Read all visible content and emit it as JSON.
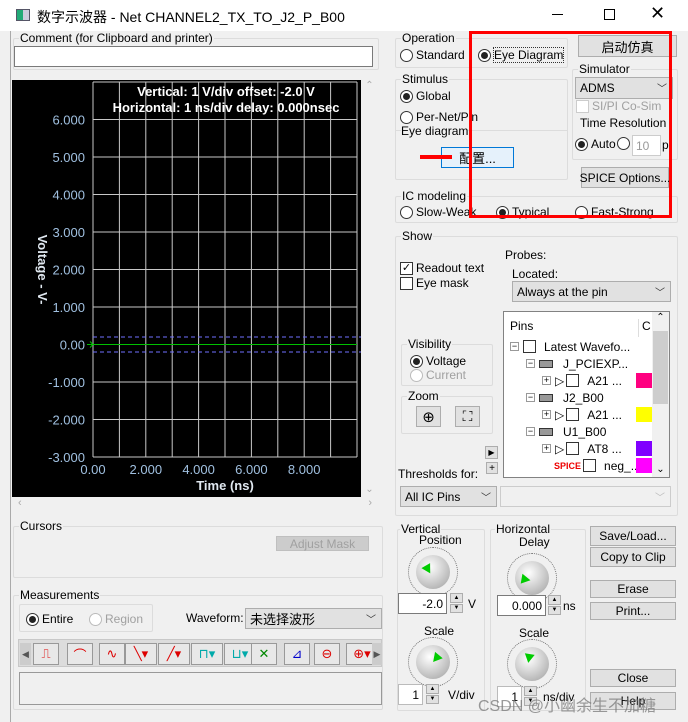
{
  "window": {
    "title": "数字示波器 - Net CHANNEL2_TX_TO_J2_P_B00",
    "controls": [
      "minimize",
      "maximize",
      "close"
    ]
  },
  "comment": {
    "label": "Comment (for Clipboard and printer)",
    "value": ""
  },
  "scope": {
    "readout_vertical": "Vertical: 1  V/div  offset: -2.0 V",
    "readout_horizontal": "Horizontal: 1 ns/div  delay: 0.000nsec"
  },
  "chart_data": {
    "type": "line",
    "xlabel": "Time  (ns)",
    "ylabel": "Voltage  - V-",
    "xlim": [
      0,
      10
    ],
    "ylim": [
      -3,
      7
    ],
    "grid": true,
    "yticks": [
      "6.000",
      "5.000",
      "4.000",
      "3.000",
      "2.000",
      "1.000",
      "0.00",
      "-1.000",
      "-2.000",
      "-3.000"
    ],
    "ytick_values": [
      6,
      5,
      4,
      3,
      2,
      1,
      0,
      -1,
      -2,
      -3
    ],
    "xticks": [
      "0.00",
      "2.000",
      "4.000",
      "6.000",
      "8.000"
    ],
    "xtick_values": [
      0,
      2,
      4,
      6,
      8
    ],
    "series": [
      {
        "x": [
          0,
          10
        ],
        "y": [
          0,
          0
        ],
        "color": "#00c000"
      }
    ],
    "threshold_lines": [
      {
        "y": 0.2,
        "color": "#7070ff",
        "style": "dashed"
      },
      {
        "y": -0.2,
        "color": "#7070ff",
        "style": "dashed"
      }
    ],
    "background": "#000000",
    "grid_color": "#c8c8c8",
    "tick_color": "#a0c0e0"
  },
  "cursors": {
    "label": "Cursors",
    "adjust_mask": "Adjust Mask"
  },
  "measurements": {
    "label": "Measurements",
    "entire": "Entire",
    "region": "Region",
    "waveform_label": "Waveform:",
    "waveform_value": "未选择波形",
    "tools": [
      "period",
      "rise",
      "fall",
      "slew-fall",
      "slew-rise",
      "overshoot-high",
      "overshoot-low",
      "crossing",
      "delay",
      "eye",
      "eye-options"
    ]
  },
  "operation": {
    "label": "Operation",
    "standard": "Standard",
    "eye_diagram": "Eye Diagram",
    "selected": "Eye Diagram"
  },
  "start_sim": "启动仿真",
  "stimulus": {
    "label": "Stimulus",
    "global": "Global",
    "per_net": "Per-Net/Pin",
    "selected": "Global"
  },
  "eye_diagram": {
    "label": "Eye diagram",
    "config": "配置..."
  },
  "simulator": {
    "label": "Simulator",
    "value": "ADMS",
    "cosim": "SI/PI Co-Sim",
    "time_res": "Time Resolution",
    "auto": "Auto",
    "ps_value": "10",
    "ps": "ps"
  },
  "spice_options": "SPICE Options...",
  "ic_modeling": {
    "label": "IC modeling",
    "slow": "Slow-Weak",
    "typical": "Typical",
    "fast": "Fast-Strong",
    "selected": "Typical"
  },
  "show": {
    "label": "Show",
    "readout": "Readout text",
    "readout_checked": true,
    "eye_mask": "Eye mask",
    "eye_mask_checked": false
  },
  "probes": {
    "label": "Probes:",
    "located": "Located:",
    "located_value": "Always at the pin"
  },
  "pins": {
    "col_pins": "Pins",
    "col_c": "C",
    "rows": [
      {
        "label": "Latest Wavefo...",
        "level": 0,
        "type": "root"
      },
      {
        "label": "J_PCIEXP...",
        "level": 1,
        "type": "ic"
      },
      {
        "label": "A21 ...",
        "level": 2,
        "type": "pin",
        "color": "#ff0080"
      },
      {
        "label": "J2_B00",
        "level": 1,
        "type": "ic"
      },
      {
        "label": "A21 ...",
        "level": 2,
        "type": "pin",
        "color": "#ffff00"
      },
      {
        "label": "U1_B00",
        "level": 1,
        "type": "ic"
      },
      {
        "label": "AT8 ...",
        "level": 2,
        "type": "pin",
        "color": "#8000ff"
      },
      {
        "label": "neg_...",
        "level": 2,
        "type": "spice",
        "color": "#ff00ff"
      }
    ]
  },
  "visibility": {
    "label": "Visibility",
    "voltage": "Voltage",
    "current": "Current"
  },
  "zoom": {
    "label": "Zoom"
  },
  "thresholds": {
    "label": "Thresholds for:",
    "value": "All IC Pins",
    "second": ""
  },
  "vertical": {
    "label": "Vertical",
    "position": "Position",
    "value": "-2.0",
    "unit": "V",
    "scale": "Scale",
    "scale_value": "1",
    "scale_unit": "V/div"
  },
  "horizontal": {
    "label": "Horizontal",
    "delay": "Delay",
    "value": "0.000",
    "unit": "ns",
    "scale": "Scale",
    "scale_value": "1",
    "scale_unit": "ns/div"
  },
  "buttons": {
    "save_load": "Save/Load...",
    "copy": "Copy to Clip",
    "erase": "Erase",
    "print": "Print...",
    "close": "Close",
    "help": "Help"
  },
  "watermark": "CSDN @小幽余生不加糖",
  "colors": {
    "highlight": "#ff0000"
  }
}
